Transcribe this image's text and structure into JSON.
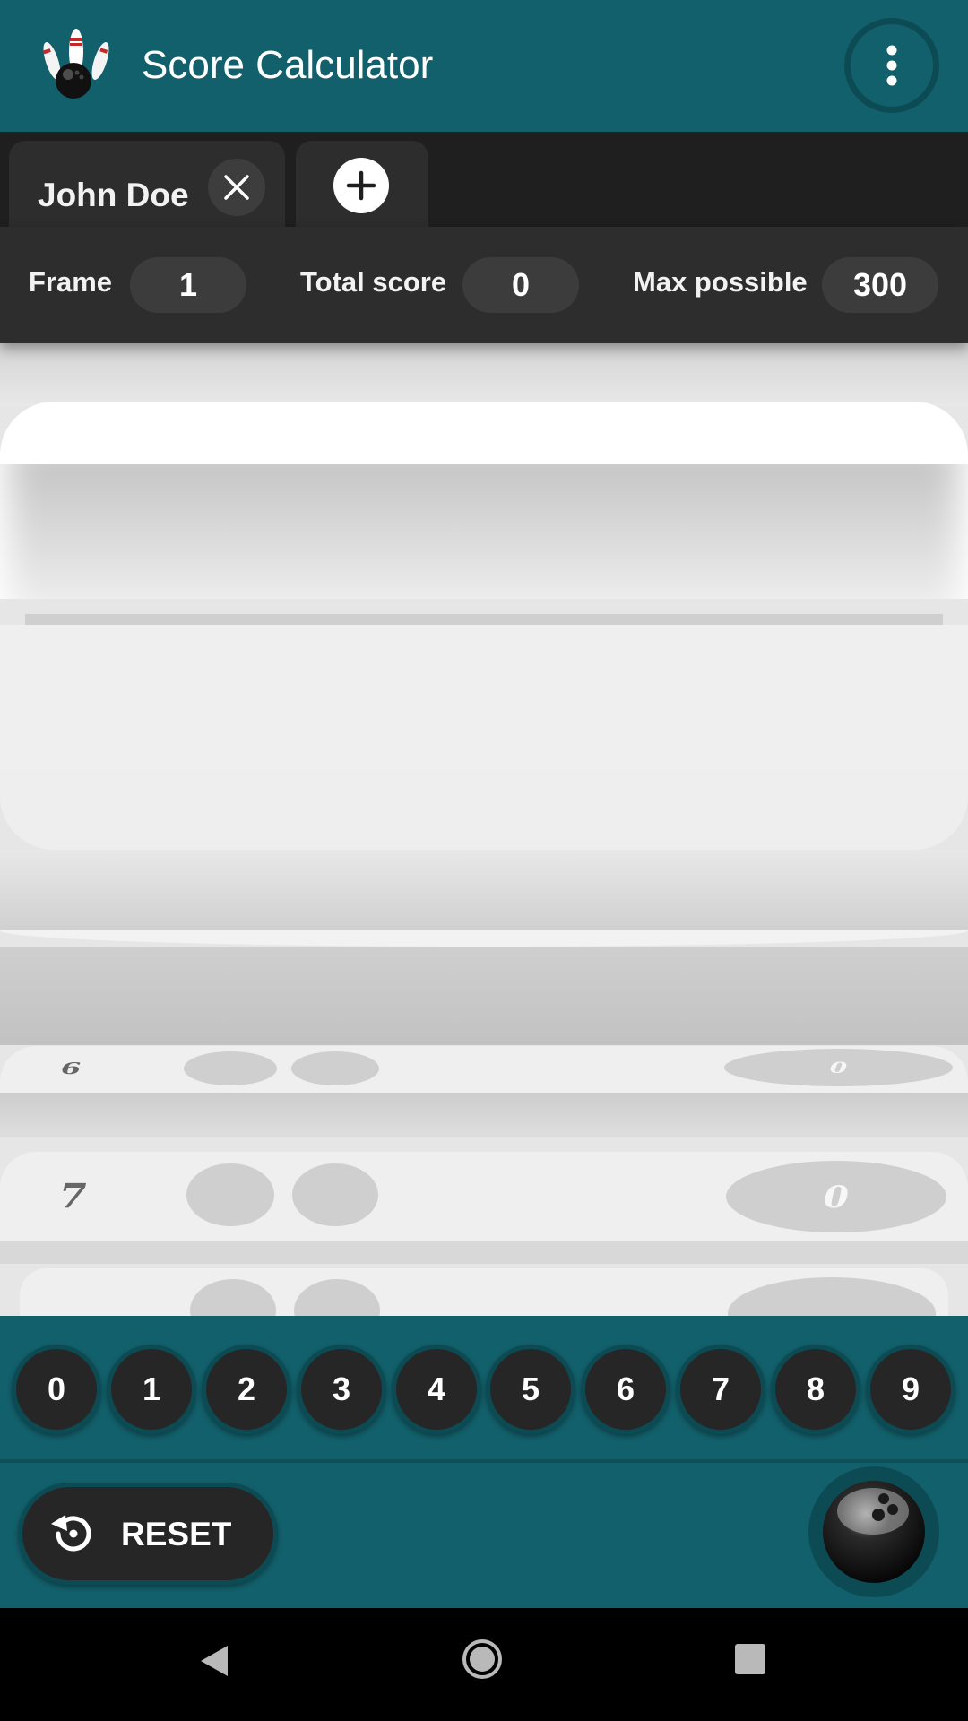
{
  "app": {
    "title": "Score Calculator",
    "logo_icon": "bowling-pins-icon",
    "menu_icon": "more-vert-icon"
  },
  "tabs": [
    {
      "name": "John Doe",
      "close_icon": "close-icon"
    },
    {
      "add_icon": "add-circle-icon"
    }
  ],
  "stats": {
    "frame_label": "Frame",
    "frame_value": "1",
    "total_label": "Total score",
    "total_value": "0",
    "max_label": "Max possible",
    "max_value": "300"
  },
  "frames": [
    {
      "number": "6",
      "score": "0"
    },
    {
      "number": "7",
      "score": "0"
    }
  ],
  "numpad": {
    "keys": [
      "0",
      "1",
      "2",
      "3",
      "4",
      "5",
      "6",
      "7",
      "8",
      "9"
    ]
  },
  "controls": {
    "reset_label": "RESET",
    "reset_icon": "restart-icon",
    "roll_icon": "bowling-ball-icon"
  },
  "colors": {
    "primary": "#12606b",
    "primary_dark": "#0d4b54",
    "surface_dark": "#2d2d2d",
    "button_dark": "#262626",
    "frames_bg": "#e6e6e6",
    "text_light": "#ffffff"
  },
  "system_nav": {
    "back_icon": "nav-back-icon",
    "home_icon": "nav-home-icon",
    "recents_icon": "nav-recents-icon"
  }
}
